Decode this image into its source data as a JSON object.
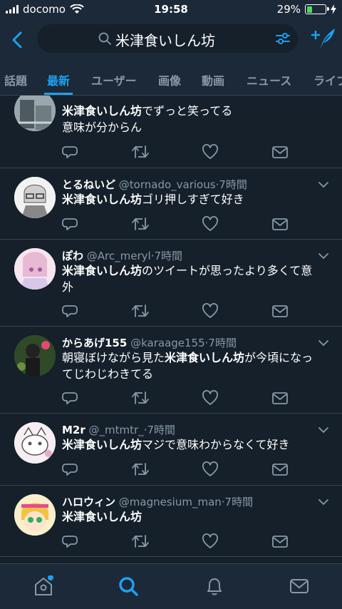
{
  "status": {
    "carrier": "docomo",
    "time": "19:58",
    "battery": "29%",
    "battery_level": 0.29
  },
  "search": {
    "query": "米津食いしん坊"
  },
  "tabs": [
    {
      "label": "話題"
    },
    {
      "label": "最新"
    },
    {
      "label": "ユーザー"
    },
    {
      "label": "画像"
    },
    {
      "label": "動画"
    },
    {
      "label": "ニュース"
    },
    {
      "label": "ライブ"
    }
  ],
  "active_tab": "最新",
  "keyword": "米津食いしん坊",
  "tweets": [
    {
      "name": "",
      "handle": "",
      "time": "",
      "pre": "",
      "kw": "米津食いしん坊",
      "post": "でずっと笑ってる",
      "line2": "意味が分からん"
    },
    {
      "name": "とるねいど",
      "handle": "@tornado_various",
      "time": "·7時間",
      "pre": "",
      "kw": "米津食いしん坊",
      "post": "ゴリ押しすぎて好き",
      "line2": ""
    },
    {
      "name": "ぽわ",
      "handle": "@Arc_meryl",
      "time": "·7時間",
      "pre": "",
      "kw": "米津食いしん坊",
      "post": "のツイートが思ったより多くて意",
      "line2": "外"
    },
    {
      "name": "からあげ155",
      "handle": "@karaage155",
      "time": "·7時間",
      "pre": "朝寝ぼけながら見た",
      "kw": "米津食いしん坊",
      "post": "が今頃になっ",
      "line2": "てじわじわきてる"
    },
    {
      "name": "M2r",
      "handle": "@_mtmtr_",
      "time": "·7時間",
      "pre": "",
      "kw": "米津食いしん坊",
      "post": "マジで意味わからなくて好き",
      "line2": ""
    },
    {
      "name": "ハロウィン",
      "handle": "@magnesium_man",
      "time": "·7時間",
      "pre": "",
      "kw": "米津食いしん坊",
      "post": "",
      "line2": ""
    }
  ],
  "colors": {
    "bg": "#15202b",
    "bar": "#1c2938",
    "accent": "#1da1f2",
    "muted": "#8899a6",
    "divider": "#38444d"
  },
  "icons": [
    "back-arrow-icon",
    "search-icon",
    "filter-icon",
    "compose-tweet-icon",
    "reply-icon",
    "retweet-icon",
    "like-icon",
    "dm-icon",
    "home-icon",
    "notifications-icon",
    "messages-icon",
    "chevron-down-icon"
  ]
}
